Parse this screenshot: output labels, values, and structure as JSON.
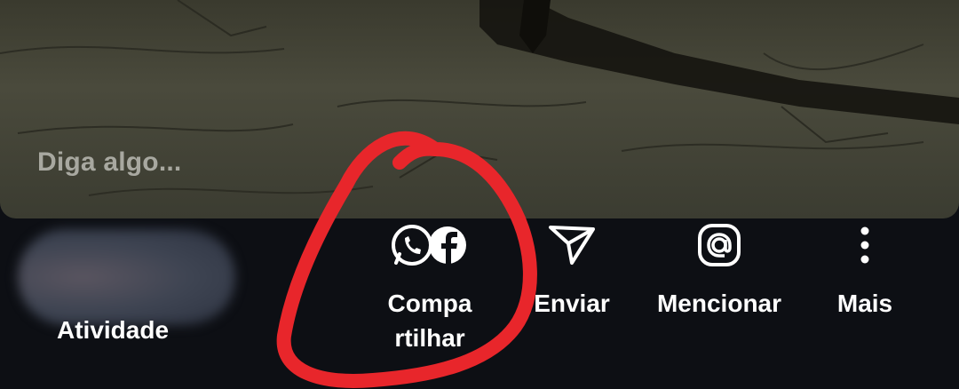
{
  "media": {
    "caption_placeholder": "Diga algo..."
  },
  "activity": {
    "label": "Atividade"
  },
  "actions": [
    {
      "label": "Compa rtilhar",
      "icon": "whatsapp-facebook-icon"
    },
    {
      "label": "Enviar",
      "icon": "send-icon"
    },
    {
      "label": "Mencionar",
      "icon": "mention-icon"
    },
    {
      "label": "Mais",
      "icon": "more-vertical-icon"
    }
  ],
  "colors": {
    "background": "#0d0f14",
    "text": "#ffffff",
    "annotation": "#e8262b"
  }
}
